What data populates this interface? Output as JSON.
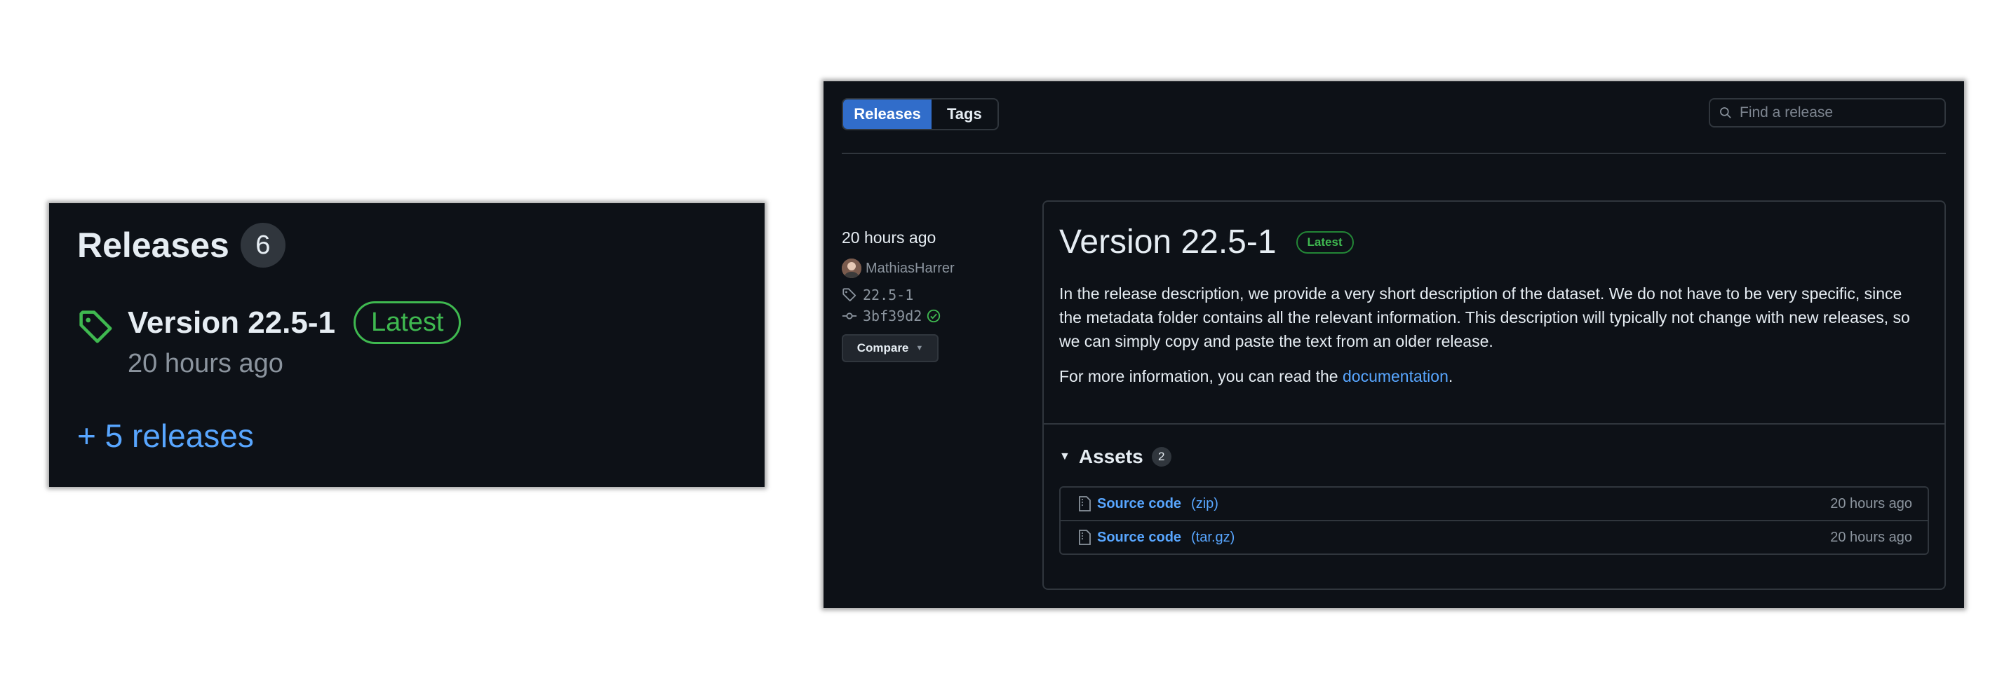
{
  "left_panel": {
    "title": "Releases",
    "count": "6",
    "version": "Version 22.5-1",
    "latest_badge": "Latest",
    "time": "20 hours ago",
    "more_releases": "+ 5 releases"
  },
  "right_panel": {
    "tabs": [
      {
        "label": "Releases",
        "active": true
      },
      {
        "label": "Tags",
        "active": false
      }
    ],
    "search_placeholder": "Find a release",
    "meta": {
      "time": "20 hours ago",
      "author": "MathiasHarrer",
      "tag": "22.5-1",
      "commit": "3bf39d2",
      "compare_label": "Compare"
    },
    "release": {
      "name": "Version 22.5-1",
      "latest_badge": "Latest",
      "description": "In the release description, we provide a very short description of the dataset. We do not have to be very specific, since the metadata folder contains all the relevant information. This description will typically not change with new releases, so we can simply copy and paste the text from an older release.",
      "more_prefix": "For more information, you can read the ",
      "more_link": "documentation",
      "more_suffix": ".",
      "assets_title": "Assets",
      "assets_count": "2",
      "assets": [
        {
          "name": "Source code",
          "ext": "(zip)",
          "time": "20 hours ago"
        },
        {
          "name": "Source code",
          "ext": "(tar.gz)",
          "time": "20 hours ago"
        }
      ]
    }
  },
  "colors": {
    "background": "#0d1117",
    "accent_blue": "#58a6ff",
    "tab_active": "#316dca",
    "latest_green": "#3fb950",
    "border": "#30363d"
  }
}
